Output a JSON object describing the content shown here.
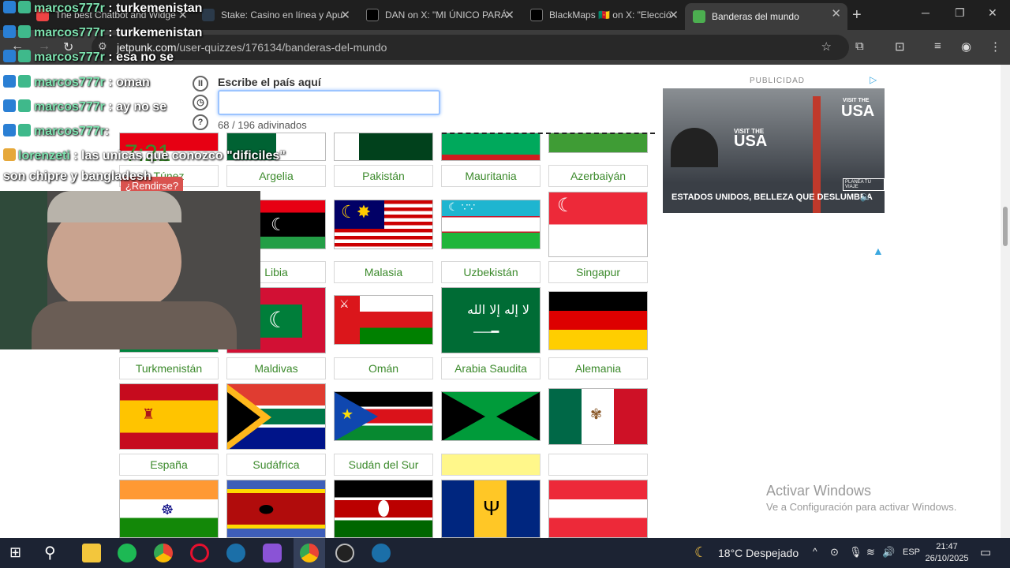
{
  "browser": {
    "tabs": [
      {
        "title": "The best Chatbot and Widge",
        "color": "#e44"
      },
      {
        "title": "Stake: Casino en línea y Apu",
        "color": "#2b3a4a"
      },
      {
        "title": "DAN on X: \"MI ÚNICO PARÁ",
        "color": "#000"
      },
      {
        "title": "BlackMaps 🇨🇲 on X: \"Elecció",
        "color": "#000"
      },
      {
        "title": "Banderas del mundo",
        "color": "#4caf50"
      }
    ],
    "url_host": "jetpunk.com",
    "url_path": "/user-quizzes/176134/banderas-del-mundo"
  },
  "quiz": {
    "input_label": "Escribe el país aquí",
    "input_value": "",
    "guess_count": "68 / 196 adivinados",
    "timer": "7:21",
    "give_up": "¿Rendirse?"
  },
  "ad": {
    "label": "PUBLICIDAD",
    "headline": "ESTADOS UNIDOS, BELLEZA QUE DESLUMBRA",
    "brand": "USA",
    "visit": "VISIT THE",
    "cta": "PLANEA TU VIAJE"
  },
  "flags": {
    "row1": [
      "Túnez",
      "Argelia",
      "Pakistán",
      "Mauritania",
      "Azerbaiyán"
    ],
    "row2": [
      "Libia",
      "Malasia",
      "Uzbekistán",
      "Singapur"
    ],
    "row3": [
      "Turkmenistán",
      "Maldivas",
      "Omán",
      "Arabia Saudita",
      "Alemania"
    ],
    "row4": [
      "España",
      "Sudáfrica",
      "Sudán del Sur",
      "",
      ""
    ]
  },
  "chat": [
    {
      "user": "marcos777r",
      "msg": ": turkemenistan"
    },
    {
      "user": "marcos777r",
      "msg": ": esa no se"
    },
    {
      "user": "marcos777r",
      "msg": ": oman"
    },
    {
      "user": "marcos777r",
      "msg": ": ay no se"
    },
    {
      "user": "marcos777r",
      "msg": ": "
    },
    {
      "user": "lorenzeti",
      "msg": ": las unicas que conozco \"dificiles\""
    },
    {
      "user": "",
      "msg": "son chipre y bangladesh"
    }
  ],
  "windows": {
    "activate_title": "Activar Windows",
    "activate_sub": "Ve a Configuración para activar Windows."
  },
  "taskbar": {
    "weather": "18°C  Despejado",
    "lang": "ESP",
    "time": "21:47",
    "date": "26/10/2025"
  }
}
